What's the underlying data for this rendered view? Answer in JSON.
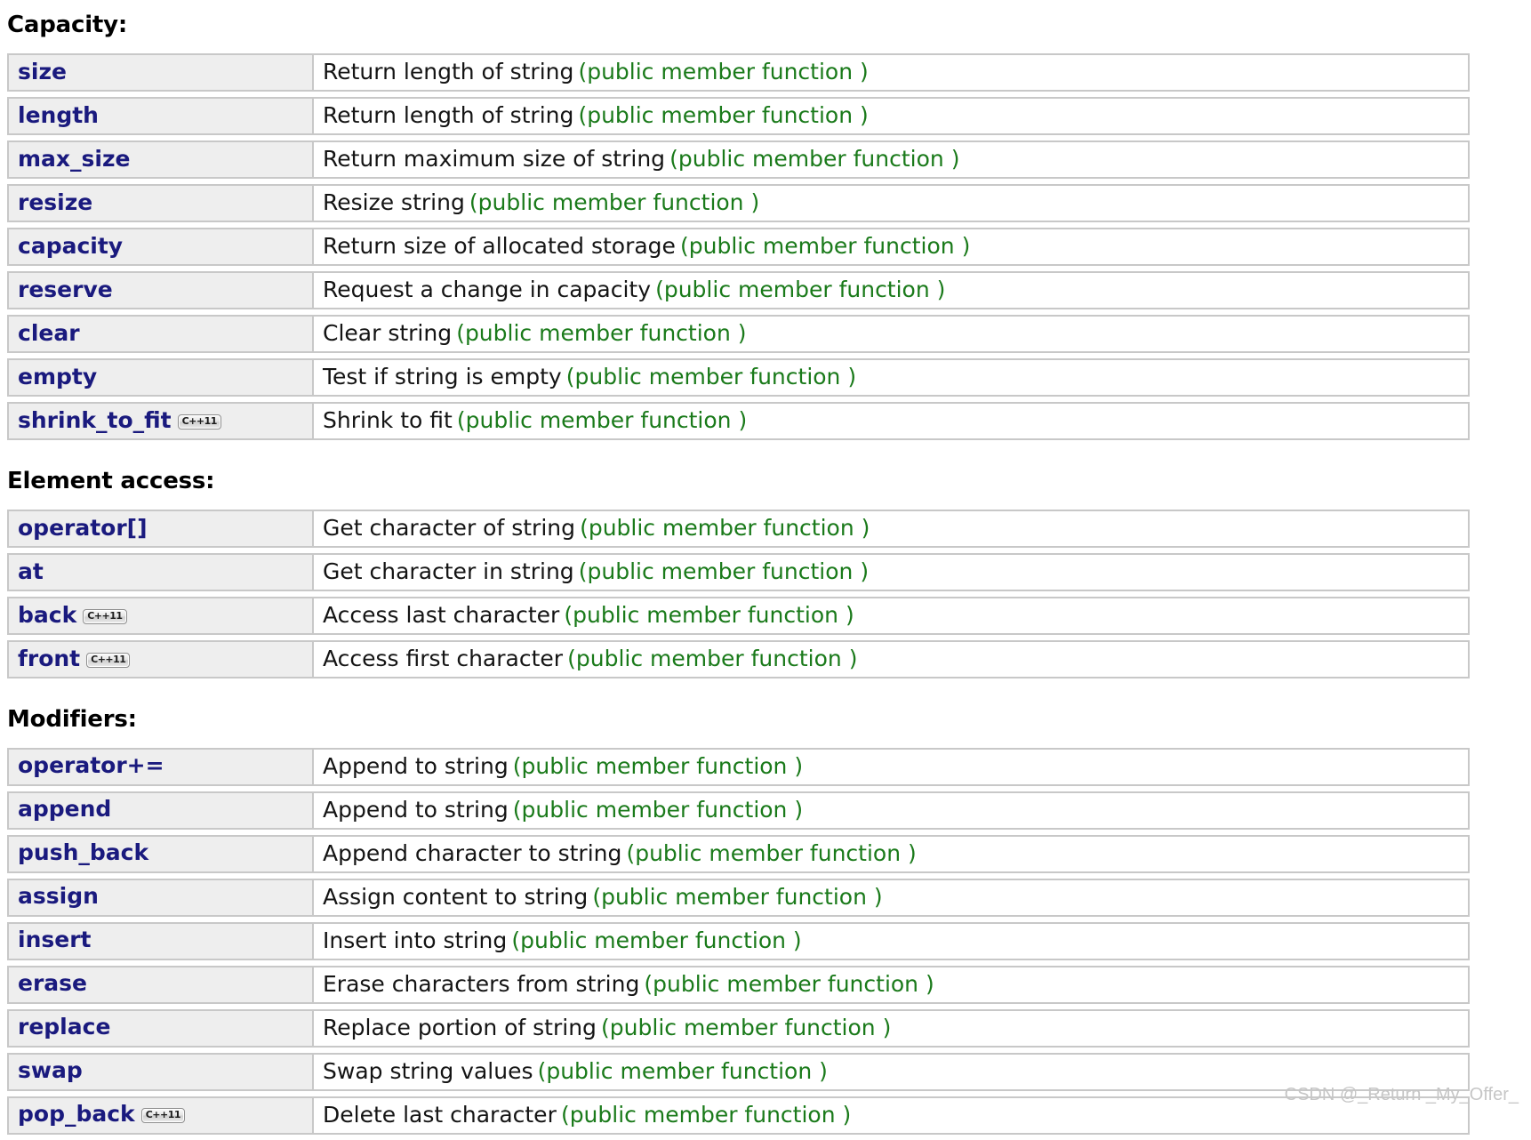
{
  "badge_label": "C++11",
  "member_kind_label": "(public member function )",
  "watermark": "CSDN @_Return _My_Offer_",
  "sections": [
    {
      "title": "Capacity:",
      "rows": [
        {
          "name": "size",
          "badge": false,
          "desc": "Return length of string"
        },
        {
          "name": "length",
          "badge": false,
          "desc": "Return length of string"
        },
        {
          "name": "max_size",
          "badge": false,
          "desc": "Return maximum size of string"
        },
        {
          "name": "resize",
          "badge": false,
          "desc": "Resize string"
        },
        {
          "name": "capacity",
          "badge": false,
          "desc": "Return size of allocated storage"
        },
        {
          "name": "reserve",
          "badge": false,
          "desc": "Request a change in capacity"
        },
        {
          "name": "clear",
          "badge": false,
          "desc": "Clear string"
        },
        {
          "name": "empty",
          "badge": false,
          "desc": "Test if string is empty"
        },
        {
          "name": "shrink_to_fit",
          "badge": true,
          "desc": "Shrink to fit"
        }
      ]
    },
    {
      "title": "Element access:",
      "rows": [
        {
          "name": "operator[]",
          "badge": false,
          "desc": "Get character of string"
        },
        {
          "name": "at",
          "badge": false,
          "desc": "Get character in string"
        },
        {
          "name": "back",
          "badge": true,
          "desc": "Access last character"
        },
        {
          "name": "front",
          "badge": true,
          "desc": "Access first character"
        }
      ]
    },
    {
      "title": "Modifiers:",
      "rows": [
        {
          "name": "operator+=",
          "badge": false,
          "desc": "Append to string"
        },
        {
          "name": "append",
          "badge": false,
          "desc": "Append to string"
        },
        {
          "name": "push_back",
          "badge": false,
          "desc": "Append character to string"
        },
        {
          "name": "assign",
          "badge": false,
          "desc": "Assign content to string"
        },
        {
          "name": "insert",
          "badge": false,
          "desc": "Insert into string"
        },
        {
          "name": "erase",
          "badge": false,
          "desc": "Erase characters from string"
        },
        {
          "name": "replace",
          "badge": false,
          "desc": "Replace portion of string"
        },
        {
          "name": "swap",
          "badge": false,
          "desc": "Swap string values"
        },
        {
          "name": "pop_back",
          "badge": true,
          "desc": "Delete last character"
        }
      ]
    }
  ]
}
